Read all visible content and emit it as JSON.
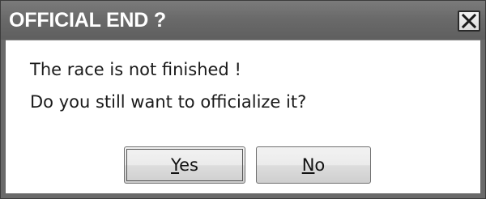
{
  "dialog": {
    "title": "OFFICIAL END ?",
    "close_icon": "close-icon",
    "message_line1": "The race is not finished !",
    "message_line2": "Do you still want to officialize it?",
    "buttons": {
      "yes": {
        "mnemonic": "Y",
        "rest": "es"
      },
      "no": {
        "mnemonic": "N",
        "rest": "o"
      }
    }
  },
  "colors": {
    "titlebar": "#6a6a6a",
    "title_text": "#ffffff",
    "content_bg": "#ffffff"
  }
}
